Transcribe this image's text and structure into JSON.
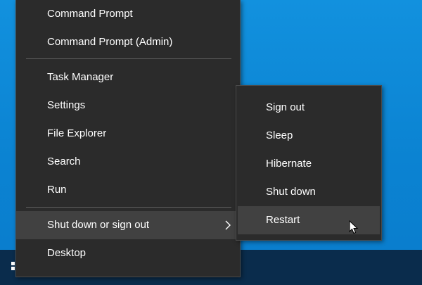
{
  "menu": {
    "items": [
      {
        "label": "Command Prompt"
      },
      {
        "label": "Command Prompt (Admin)"
      },
      {
        "label": "Task Manager"
      },
      {
        "label": "Settings"
      },
      {
        "label": "File Explorer"
      },
      {
        "label": "Search"
      },
      {
        "label": "Run"
      },
      {
        "label": "Shut down or sign out",
        "has_submenu": true,
        "active": true
      },
      {
        "label": "Desktop"
      }
    ]
  },
  "submenu": {
    "items": [
      {
        "label": "Sign out"
      },
      {
        "label": "Sleep"
      },
      {
        "label": "Hibernate"
      },
      {
        "label": "Shut down"
      },
      {
        "label": "Restart",
        "hovered": true
      }
    ]
  },
  "icons": {
    "start": "windows-logo-icon",
    "submenu_arrow": "chevron-right-icon",
    "pointer": "mouse-pointer-icon"
  },
  "colors": {
    "menu_background": "#2b2b2b",
    "item_highlight": "#414141",
    "text": "#ffffff",
    "desktop": "#0b83d2",
    "taskbar": "#0a2c4c"
  }
}
